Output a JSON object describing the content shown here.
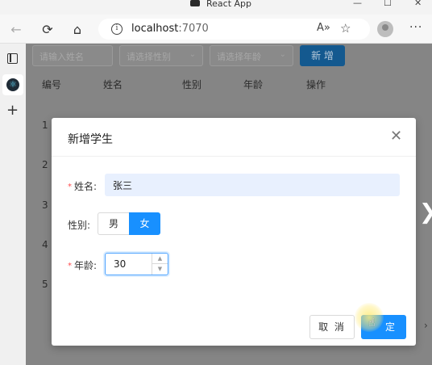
{
  "browser": {
    "tab_title": "React App",
    "window_buttons": [
      "—",
      "☐",
      "✕"
    ],
    "url_host": "localhost",
    "url_port": ":7070"
  },
  "icons": {
    "back": "←",
    "refresh": "⟳",
    "home": "⌂",
    "info": "i",
    "read_aloud": "A»",
    "favorite": "☆",
    "more": "···",
    "new_tab": "+",
    "react": "⚛",
    "close": "✕",
    "chevron_down": "⌄",
    "right_chevron": "❯",
    "small_right_chevron": "›",
    "hand_cursor": "☝",
    "spin_up": "▲",
    "spin_down": "▼"
  },
  "filters": {
    "name_placeholder": "请输入姓名",
    "gender_placeholder": "请选择性别",
    "age_placeholder": "请选择年龄",
    "add_button": "新 增"
  },
  "table": {
    "headers": [
      "编号",
      "姓名",
      "性别",
      "年龄",
      "操作"
    ],
    "row_numbers": [
      "1",
      "2",
      "3",
      "4",
      "5"
    ]
  },
  "modal": {
    "title": "新增学生",
    "name_label": "姓名:",
    "name_value": "张三",
    "gender_label": "性别:",
    "gender_options": [
      "男",
      "女"
    ],
    "gender_selected": "女",
    "age_label": "年龄:",
    "age_value": "30",
    "required_mark": "*",
    "cancel_button": "取 消",
    "ok_button": "确 定",
    "ok_button_visible": "定"
  },
  "colors": {
    "primary": "#1890ff",
    "required": "#ff4d4f",
    "autofill_bg": "#e8f0fe"
  }
}
